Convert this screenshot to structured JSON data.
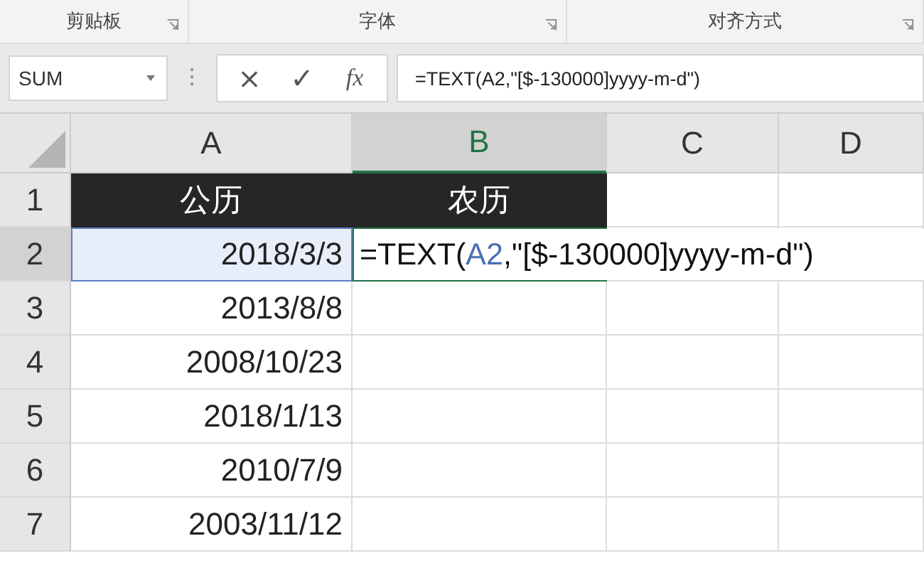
{
  "ribbon_groups": [
    {
      "label": "剪贴板",
      "launcher": true
    },
    {
      "label": "字体",
      "launcher": true
    },
    {
      "label": "对齐方式",
      "launcher": true
    }
  ],
  "formula_bar": {
    "name_box": "SUM",
    "buttons": [
      "×",
      "✓",
      "fx"
    ],
    "formula": "=TEXT(A2,\"[$-130000]yyyy-m-d\")"
  },
  "columns": [
    {
      "label": "A",
      "selected": false
    },
    {
      "label": "B",
      "selected": true
    },
    {
      "label": "C",
      "selected": false
    },
    {
      "label": "D",
      "selected": false
    }
  ],
  "rows": [
    {
      "label": "1",
      "cells": [
        "公历",
        "农历"
      ],
      "header": true
    },
    {
      "label": "2",
      "cells": [
        "2018/3/3",
        ""
      ],
      "header": false,
      "editing": [
        {
          "text": "=TEXT(",
          "ref": false
        },
        {
          "text": "A2",
          "ref": true
        },
        {
          "text": ",\"[$-130000]yyyy-m-d\")",
          "ref": false
        }
      ]
    },
    {
      "label": "3",
      "cells": [
        "2013/8/8",
        ""
      ],
      "header": false
    },
    {
      "label": "4",
      "cells": [
        "2008/10/23",
        ""
      ],
      "header": false
    },
    {
      "label": "5",
      "cells": [
        "2018/1/13",
        ""
      ],
      "header": false
    },
    {
      "label": "6",
      "cells": [
        "2010/7/9",
        ""
      ],
      "header": false
    },
    {
      "label": "7",
      "cells": [
        "2003/11/12",
        ""
      ],
      "header": false
    }
  ]
}
